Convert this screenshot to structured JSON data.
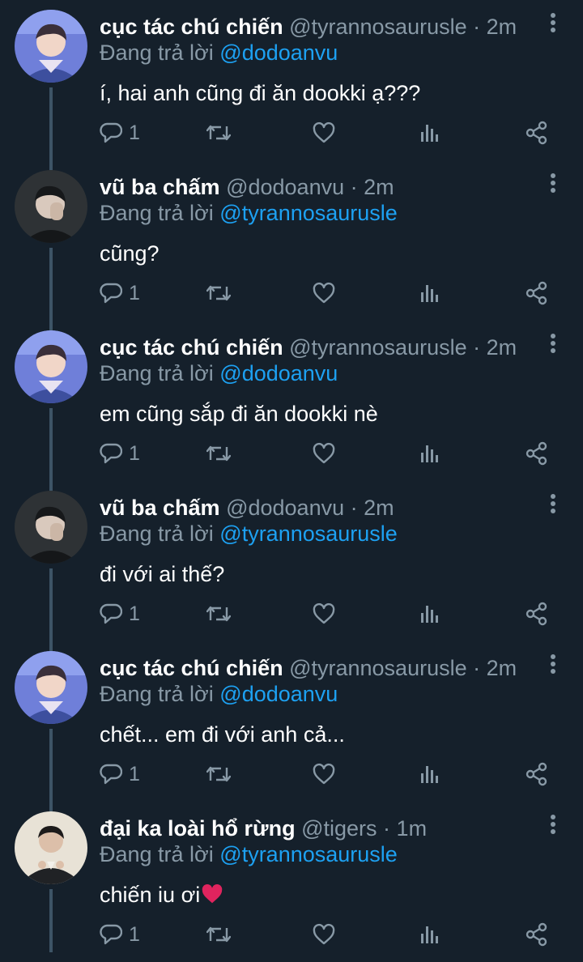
{
  "colors": {
    "background": "#15202b",
    "secondary_text": "#8899a6",
    "link": "#1da1f2",
    "thread_line": "#3d5466"
  },
  "reply_prefix": "Đang trả lời",
  "tweets": [
    {
      "name": "cục tác chú chiến",
      "handle": "@tyrannosaurusle",
      "sep": " · ",
      "time": "2m",
      "reply_to": "@dodoanvu",
      "text": "í, hai anh cũng đi ăn dookki ạ???",
      "reply_count": "1",
      "avatar": "avatar-blue"
    },
    {
      "name": "vũ ba chấm",
      "handle": "@dodoanvu",
      "sep": " · ",
      "time": "2m",
      "reply_to": "@tyrannosaurusle",
      "text": "cũng?",
      "reply_count": "1",
      "avatar": "avatar-dark"
    },
    {
      "name": "cục tác chú chiến",
      "handle": "@tyrannosaurusle",
      "sep": " · ",
      "time": "2m",
      "reply_to": "@dodoanvu",
      "text": "em cũng sắp đi ăn dookki nè",
      "reply_count": "1",
      "avatar": "avatar-blue"
    },
    {
      "name": "vũ ba chấm",
      "handle": "@dodoanvu",
      "sep": " · ",
      "time": "2m",
      "reply_to": "@tyrannosaurusle",
      "text": "đi với ai thế?",
      "reply_count": "1",
      "avatar": "avatar-dark"
    },
    {
      "name": "cục tác chú chiến",
      "handle": "@tyrannosaurusle",
      "sep": " · ",
      "time": "2m",
      "reply_to": "@dodoanvu",
      "text": "chết... em đi với anh cả...",
      "reply_count": "1",
      "avatar": "avatar-blue"
    },
    {
      "name": "đại ka loài hổ rừng",
      "handle": "@tigers",
      "sep": " · ",
      "time": "1m",
      "reply_to": "@tyrannosaurusle",
      "text": "chiến iu ơi",
      "emoji": "red-heart-icon",
      "reply_count": "1",
      "avatar": "avatar-light"
    }
  ]
}
